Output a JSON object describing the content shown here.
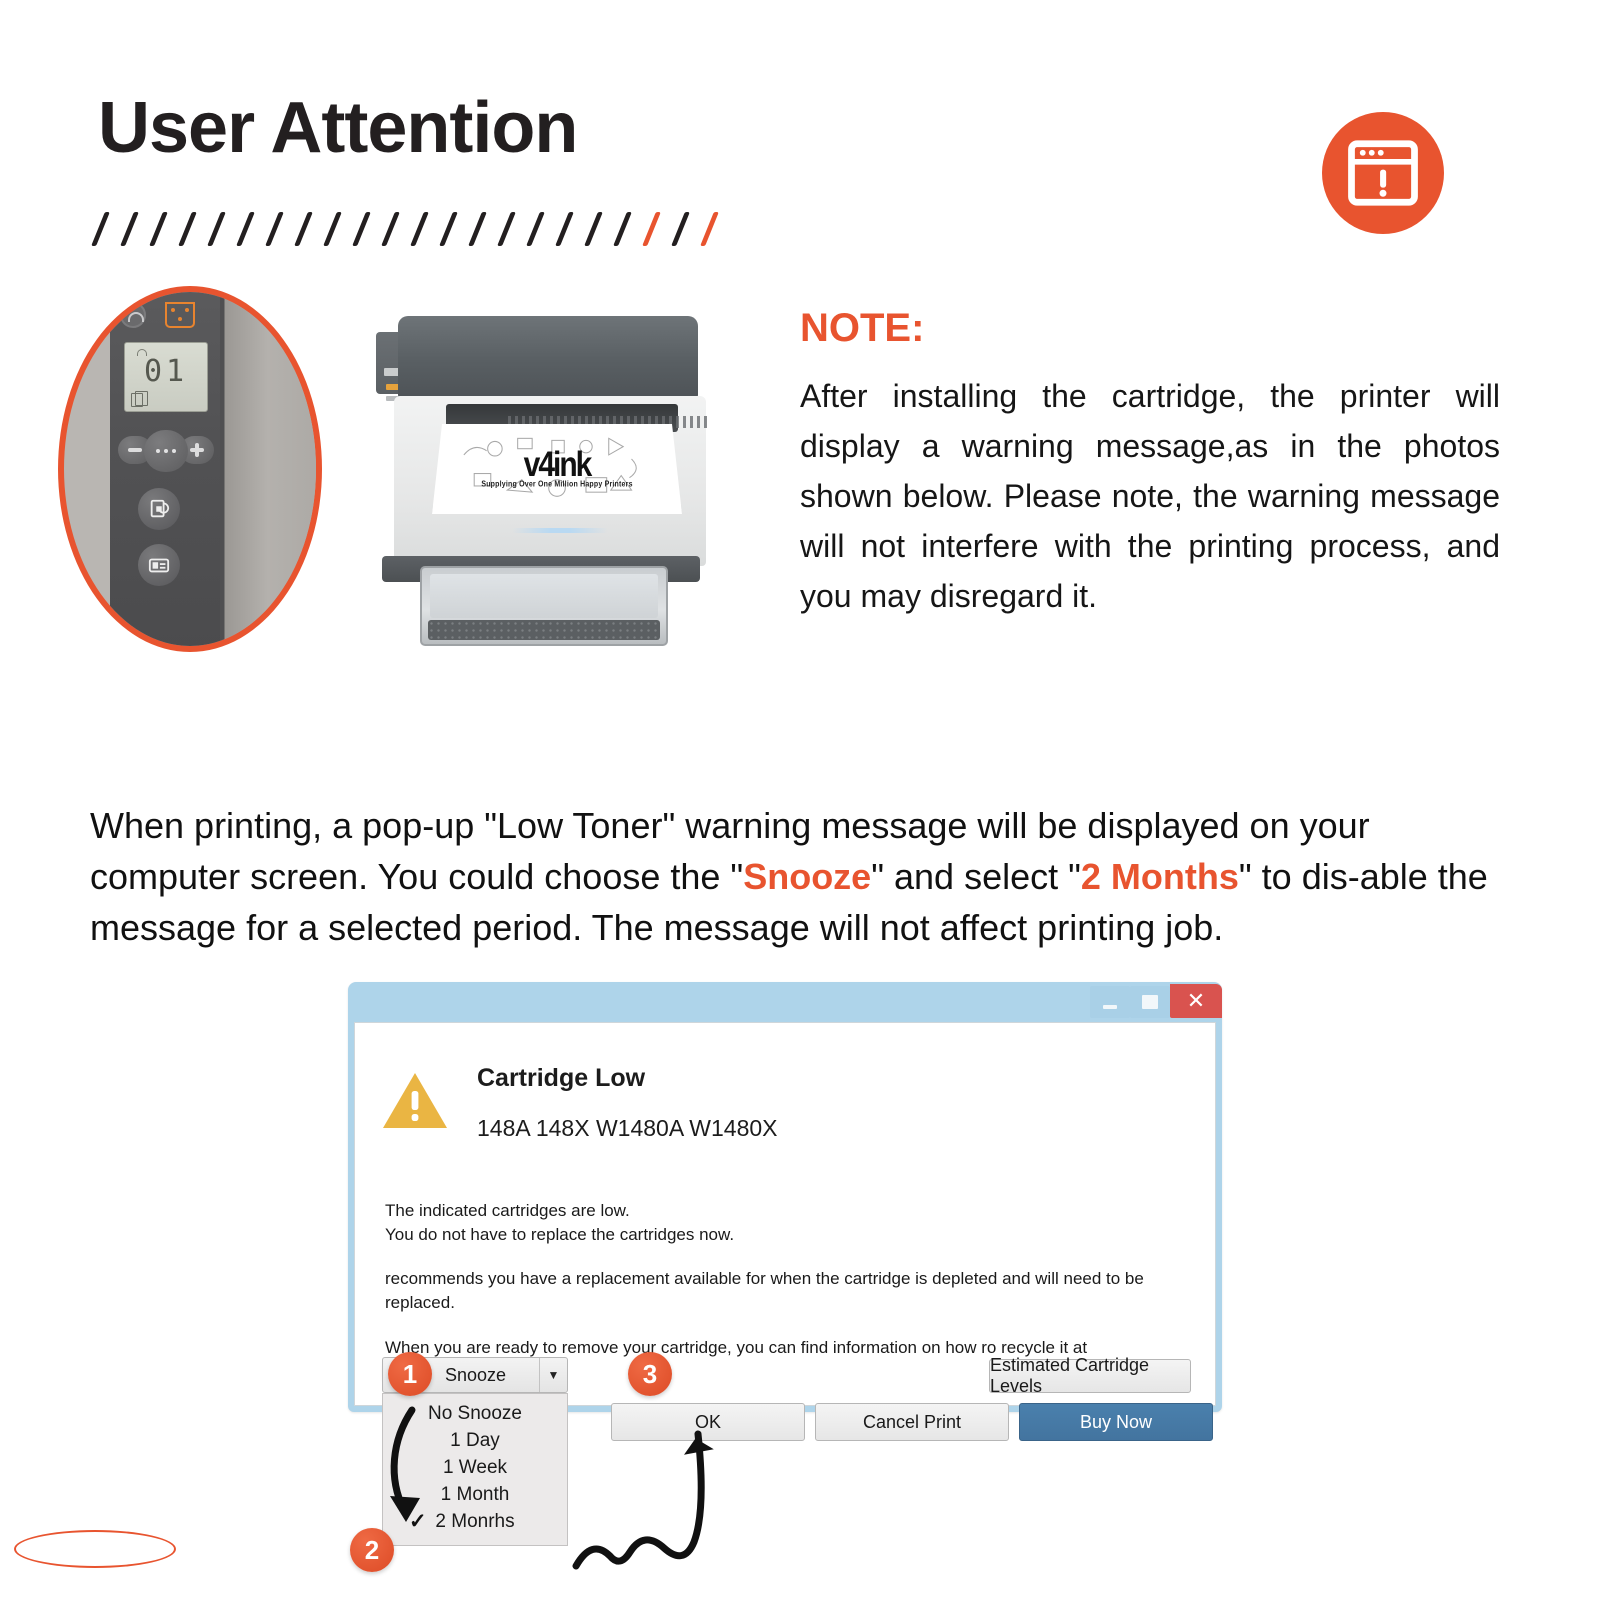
{
  "header": {
    "title": "User Attention",
    "accent_color": "#e8542f",
    "hatch_count": 22,
    "hatch_accent_indexes": [
      19,
      21
    ],
    "badge_icon": "window-alert-icon"
  },
  "photo": {
    "magnifier_icon": "magnifier-ellipse",
    "panel": {
      "wifi_button_icon": "wifi-icon",
      "toner_indicator_icon": "toner-low-icon",
      "lcd_value": "01",
      "lcd_doc_icon": "document-icon",
      "lcd_wifi_icon": "wifi-small-icon",
      "minus_button_icon": "minus-icon",
      "menu_button_icon": "ellipsis-icon",
      "plus_button_icon": "plus-icon",
      "resume_button_icon": "resume-job-icon",
      "id_copy_button_icon": "id-copy-icon"
    },
    "printer_watermark": {
      "brand": "v4ink",
      "tagline": "Supplying Over One Million Happy Printers"
    }
  },
  "note": {
    "heading": "NOTE:",
    "body": "After installing the cartridge, the printer will display a warning message,as in the photos shown below. Please note, the warning message will not interfere with the printing process, and you may disregard it."
  },
  "mid_paragraph": {
    "part1": "When printing, a pop-up \"Low Toner\" warning message will be displayed on your computer screen. You could choose the \"",
    "highlight1": "Snooze",
    "part2": "\" and select \"",
    "highlight2": "2 Months",
    "part3": "\" to dis-able the message for a selected period. The message will not affect printing job."
  },
  "dialog": {
    "titlebar": {
      "minimize_label": "",
      "maximize_label": "",
      "close_label": "✕"
    },
    "warning_icon": "warning-triangle-icon",
    "title": "Cartridge Low",
    "subtitle": "148A 148X W1480A W1480X",
    "paragraphs": [
      "The indicated cartridges are low.",
      "You do not have to replace the cartridges now.",
      "recommends you have a replacement available for when the cartridge is depleted and will need to be replaced.",
      "When you are ready to remove your cartridge, you can find information on how ro recycle it at "
    ],
    "buttons": {
      "estimated_levels": "Estimated Cartridge Levels",
      "ok": "OK",
      "cancel_print": "Cancel Print",
      "buy_now": "Buy Now"
    },
    "combo": {
      "value": "Snooze",
      "arrow_icon": "chevron-down-icon",
      "options": [
        "No Snooze",
        "1 Day",
        "1 Week",
        "1 Month",
        "2 Monrhs"
      ],
      "selected_option": "2 Monrhs",
      "check_icon": "check-icon"
    }
  },
  "steps": {
    "one": "1",
    "two": "2",
    "three": "3"
  }
}
